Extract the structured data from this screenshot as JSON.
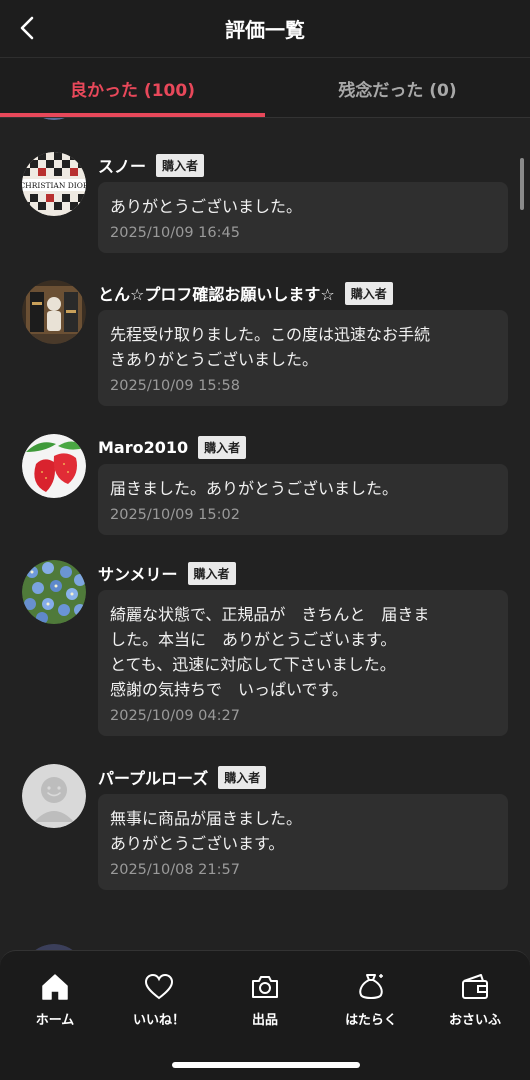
{
  "header": {
    "title": "評価一覧",
    "back_icon": "chevron-left-icon"
  },
  "tabs": [
    {
      "label": "良かった (100)",
      "active": true
    },
    {
      "label": "残念だった (0)",
      "active": false
    }
  ],
  "reviews": [
    {
      "user": "スノー",
      "badge": "購入者",
      "comment": "ありがとうございました。",
      "date": "2025/10/09 16:45",
      "avatar": "christian-dior-avatar"
    },
    {
      "user": "とん☆プロフ確認お願いします☆",
      "badge": "購入者",
      "comment": "先程受け取りました。この度は迅速なお手続\nきありがとうございました。",
      "date": "2025/10/09 15:58",
      "avatar": "figurine-avatar"
    },
    {
      "user": "Maro2010",
      "badge": "購入者",
      "comment": "届きました。ありがとうございました。",
      "date": "2025/10/09 15:02",
      "avatar": "strawberry-avatar"
    },
    {
      "user": "サンメリー",
      "badge": "購入者",
      "comment": "綺麗な状態で、正規品が　きちんと　届きま\nした。本当に　ありがとうございます。\nとても、迅速に対応して下さいました。\n感謝の気持ちで　いっぱいです。",
      "date": "2025/10/09 04:27",
      "avatar": "blue-flowers-avatar"
    },
    {
      "user": "パープルローズ",
      "badge": "購入者",
      "comment": "無事に商品が届きました。\nありがとうございます。\n",
      "date": "2025/10/08 21:57",
      "avatar": "default-avatar"
    }
  ],
  "bottom_nav": [
    {
      "label": "ホーム",
      "icon": "home-icon"
    },
    {
      "label": "いいね！",
      "icon": "heart-icon"
    },
    {
      "label": "出品",
      "icon": "camera-icon"
    },
    {
      "label": "はたらく",
      "icon": "money-bag-icon"
    },
    {
      "label": "おさいふ",
      "icon": "wallet-icon"
    }
  ],
  "colors": {
    "background": "#222222",
    "accent": "#e8485a",
    "bubble": "#2f2f2f",
    "inactive_tab": "#a8a8a8"
  }
}
